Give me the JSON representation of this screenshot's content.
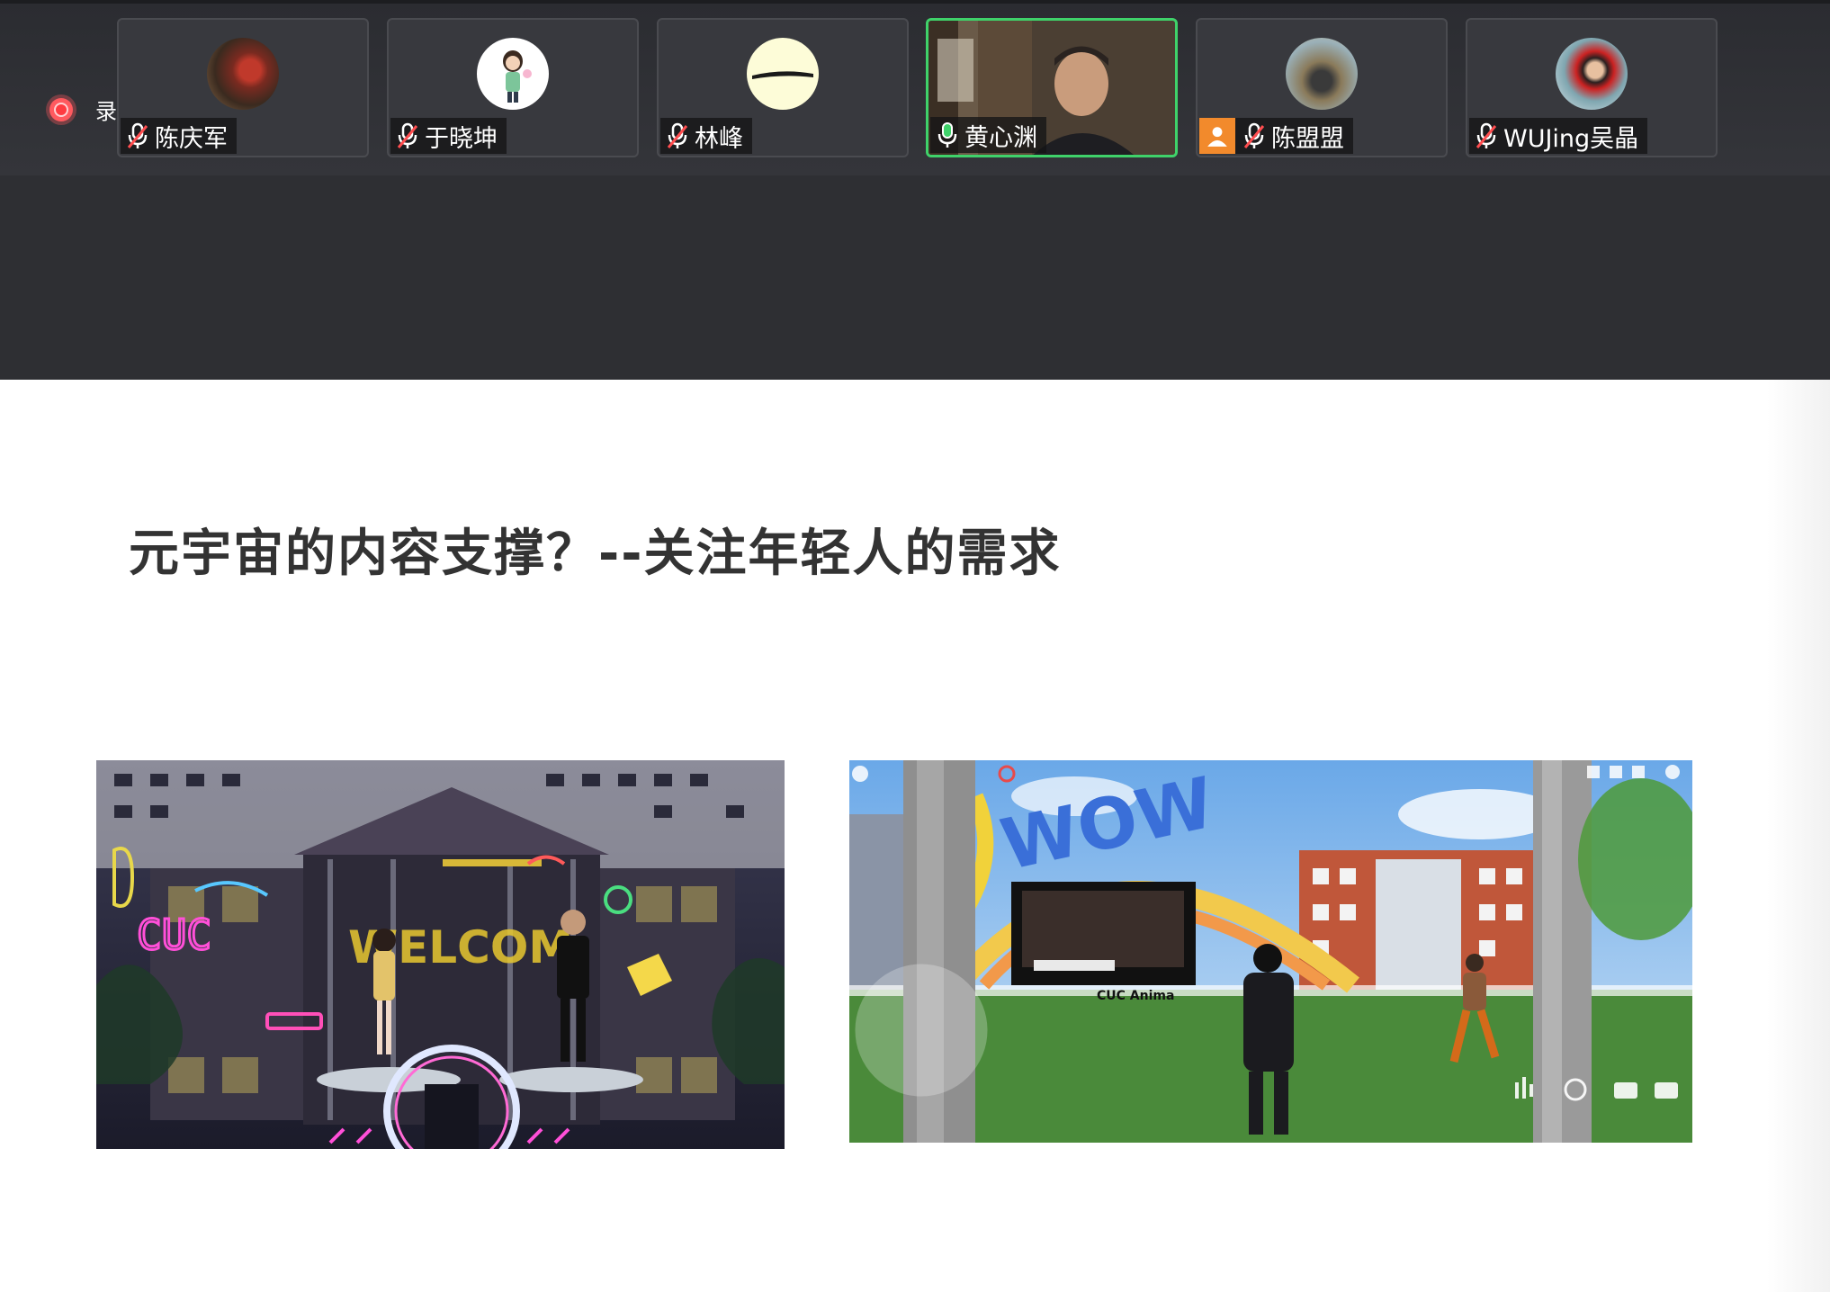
{
  "recording": {
    "label": "录制中"
  },
  "participants": [
    {
      "name": "陈庆军",
      "muted": true
    },
    {
      "name": "于晓坤",
      "muted": true
    },
    {
      "name": "林峰",
      "muted": true
    },
    {
      "name": "黄心渊",
      "muted": false,
      "speaking": true
    },
    {
      "name": "陈盟盟",
      "muted": true
    },
    {
      "name": "WUJing吴晶",
      "muted": true
    }
  ],
  "slide": {
    "title": "元宇宙的内容支撑？--关注年轻人的需求",
    "image_left": {
      "sign_text": "CUC",
      "welcome_text": "WELCOM"
    },
    "image_right": {
      "banner_text": "WOW",
      "screen_caption": "CUC Anima"
    }
  },
  "colors": {
    "active_speaker_border": "#3fd26a",
    "recording_dot": "#ff5a5f",
    "person_badge": "#f28a2c"
  }
}
